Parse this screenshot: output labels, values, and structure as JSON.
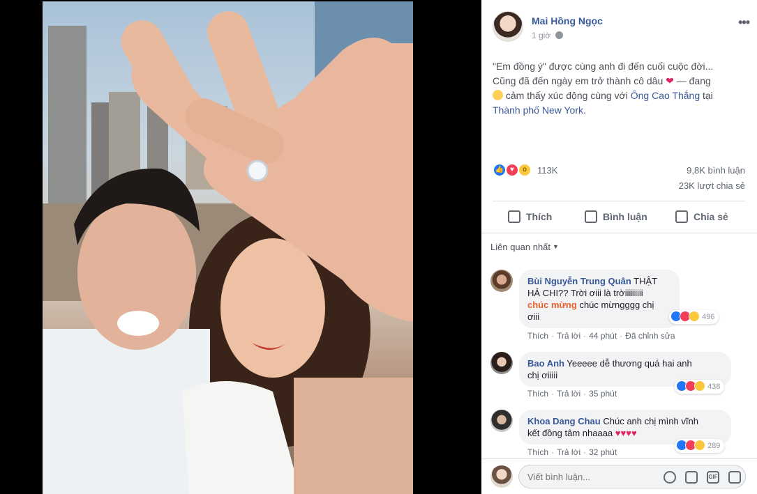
{
  "post": {
    "author": "Mai Hồng Ngọc",
    "time": "1 giờ",
    "more_label": "•••",
    "caption_line1": "\"Em đồng ý\" được cùng anh đi đến cuối cuộc đời...",
    "caption_line2a": "Cũng đã đến ngày em trở thành cô dâu",
    "caption_line2b": "— đang",
    "caption_line3": "cảm thấy xúc động cùng với",
    "tagged_person": "Ông Cao Thắng",
    "at_word": "tại",
    "location": "Thành phố New York",
    "location_end": "."
  },
  "stats": {
    "reactions": "113K",
    "comments": "9,8K bình luận",
    "shares": "23K lượt chia sẻ"
  },
  "actions": {
    "like": "Thích",
    "comment": "Bình luận",
    "share": "Chia sẻ"
  },
  "filter": {
    "label": "Liên quan nhất"
  },
  "comments": [
    {
      "name": "Bùi Nguyễn Trung Quân",
      "text1": "THẬT",
      "text2": "HẢ CHI?? Trời ơiii là trờiiiiiiiii",
      "mention": "chúc mừng",
      "text3": "chúc mừngggg chị",
      "text4": "ơiii",
      "reacts": "496",
      "like": "Thích",
      "reply": "Trả lời",
      "time": "44 phút",
      "edited": "Đã chỉnh sửa"
    },
    {
      "name": "Bao Anh",
      "text1": "Yeeeee dễ thương quá hai anh",
      "text2": "chị ơiiiii",
      "reacts": "438",
      "like": "Thích",
      "reply": "Trả lời",
      "time": "35 phút"
    },
    {
      "name": "Khoa Dang Chau",
      "text1": "Chúc anh chị mình vĩnh",
      "text2": "kết đồng tâm nhaaaa",
      "reacts": "289",
      "like": "Thích",
      "reply": "Trả lời",
      "time": "32 phút"
    }
  ],
  "composer": {
    "placeholder": "Viết bình luận...",
    "gif_label": "GIF"
  },
  "colors": {
    "link": "#385898",
    "like_blue": "#2078f4",
    "love_red": "#f33e58"
  }
}
